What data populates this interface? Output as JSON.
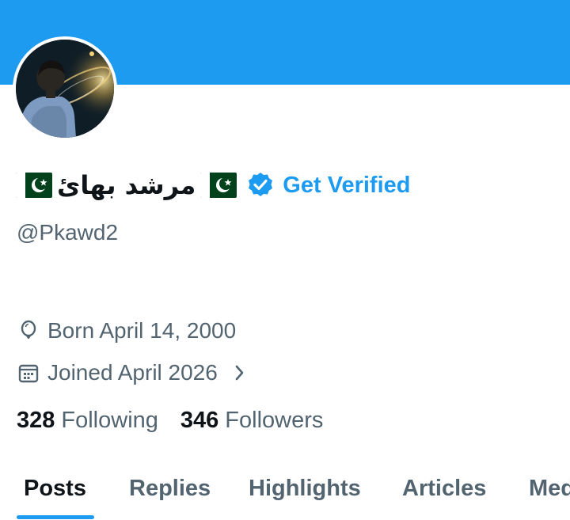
{
  "profile": {
    "display_name": "مرشد بھائ",
    "get_verified_label": "Get Verified",
    "handle": "@Pkawd2",
    "born": "Born April 14, 2000",
    "joined": "Joined April 2026"
  },
  "stats": {
    "following_count": "328",
    "following_label": "Following",
    "followers_count": "346",
    "followers_label": "Followers"
  },
  "tabs": [
    {
      "label": "Posts",
      "active": true
    },
    {
      "label": "Replies"
    },
    {
      "label": "Highlights"
    },
    {
      "label": "Articles"
    },
    {
      "label": "Media"
    }
  ],
  "icons": [
    "pakistan-flag-icon",
    "verified-badge-icon",
    "balloon-icon",
    "calendar-icon",
    "chevron-right-icon"
  ],
  "colors": {
    "accent": "#1d9bf0",
    "text": "#0f1419",
    "muted": "#536471"
  }
}
